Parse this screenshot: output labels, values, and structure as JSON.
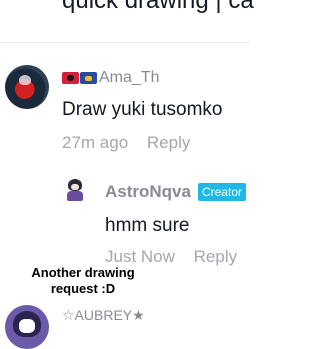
{
  "top_text": "quick drawing | ca",
  "comments": [
    {
      "flags": [
        "albania-flag",
        "kosovo-flag"
      ],
      "username": "Ama_Th",
      "text": "Draw yuki tusomko",
      "time": "27m ago",
      "reply_label": "Reply"
    },
    {
      "username": "AstroNqva",
      "badge": "Creator",
      "text": "hmm sure",
      "time": "Just Now",
      "reply_label": "Reply"
    },
    {
      "username": "☆AUBREY★"
    }
  ],
  "overlay_caption": "Another drawing request :D",
  "colors": {
    "badge": "#20b8e6",
    "muted": "#a6a7ab",
    "username": "#8a8b91",
    "text": "#161823"
  }
}
